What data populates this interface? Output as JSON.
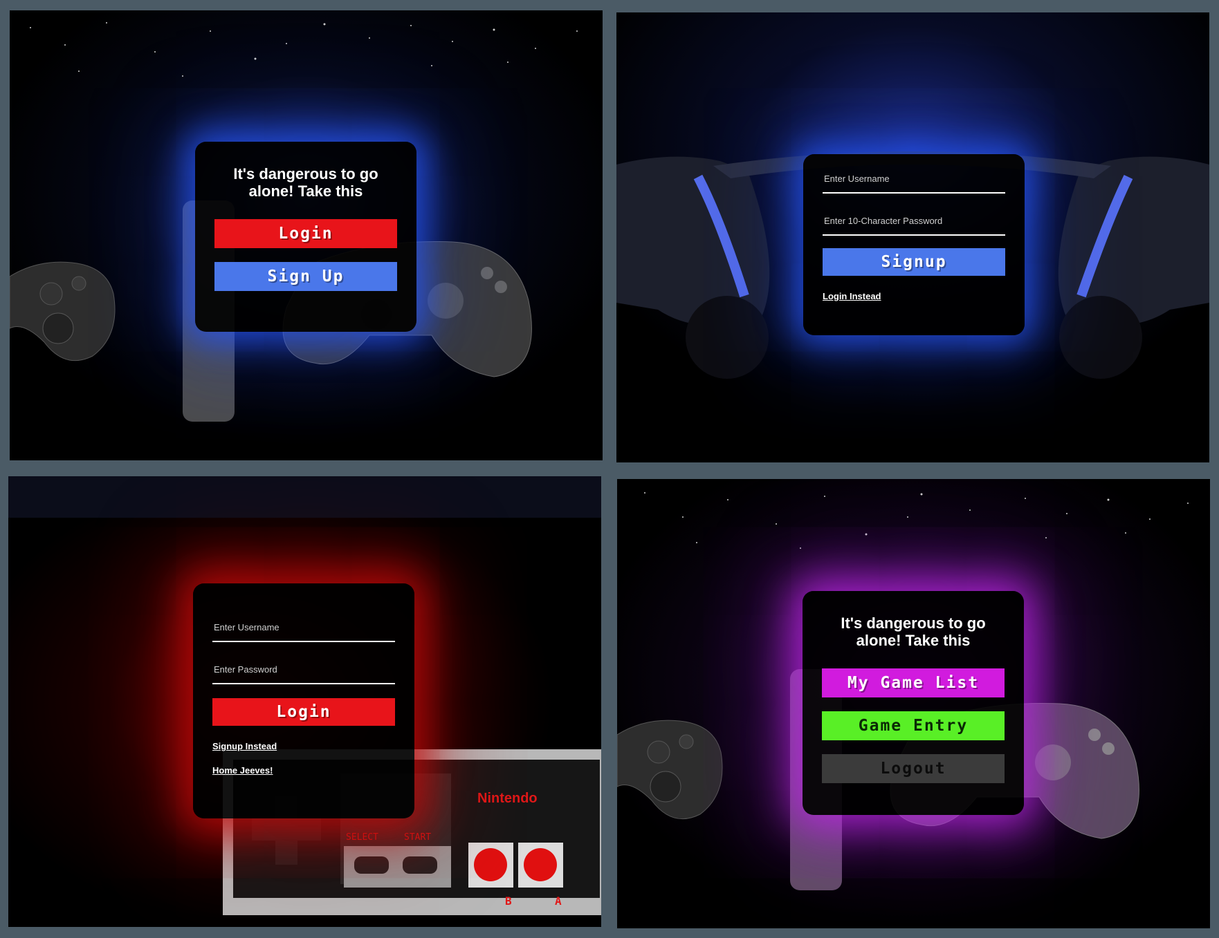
{
  "panel1": {
    "title": "It's dangerous to go alone! Take this",
    "login_label": "Login",
    "signup_label": "Sign Up"
  },
  "panel2": {
    "username_placeholder": "Enter Username",
    "password_placeholder": "Enter 10-Character Password",
    "signup_label": "Signup",
    "login_link": "Login Instead"
  },
  "panel3": {
    "username_placeholder": "Enter Username",
    "password_placeholder": "Enter Password",
    "login_label": "Login",
    "signup_link": "Signup Instead",
    "home_link": "Home Jeeves!",
    "controller_brand": "Nintendo",
    "select_label": "SELECT",
    "start_label": "START",
    "b_label": "B",
    "a_label": "A"
  },
  "panel4": {
    "title": "It's dangerous to go alone! Take this",
    "game_list_label": "My Game List",
    "game_entry_label": "Game Entry",
    "logout_label": "Logout"
  },
  "colors": {
    "login_red": "#e8141a",
    "signup_blue": "#4a77ea",
    "game_list_magenta": "#d11bde",
    "game_entry_green": "#59ef26",
    "logout_gray": "#3b3b3b"
  }
}
